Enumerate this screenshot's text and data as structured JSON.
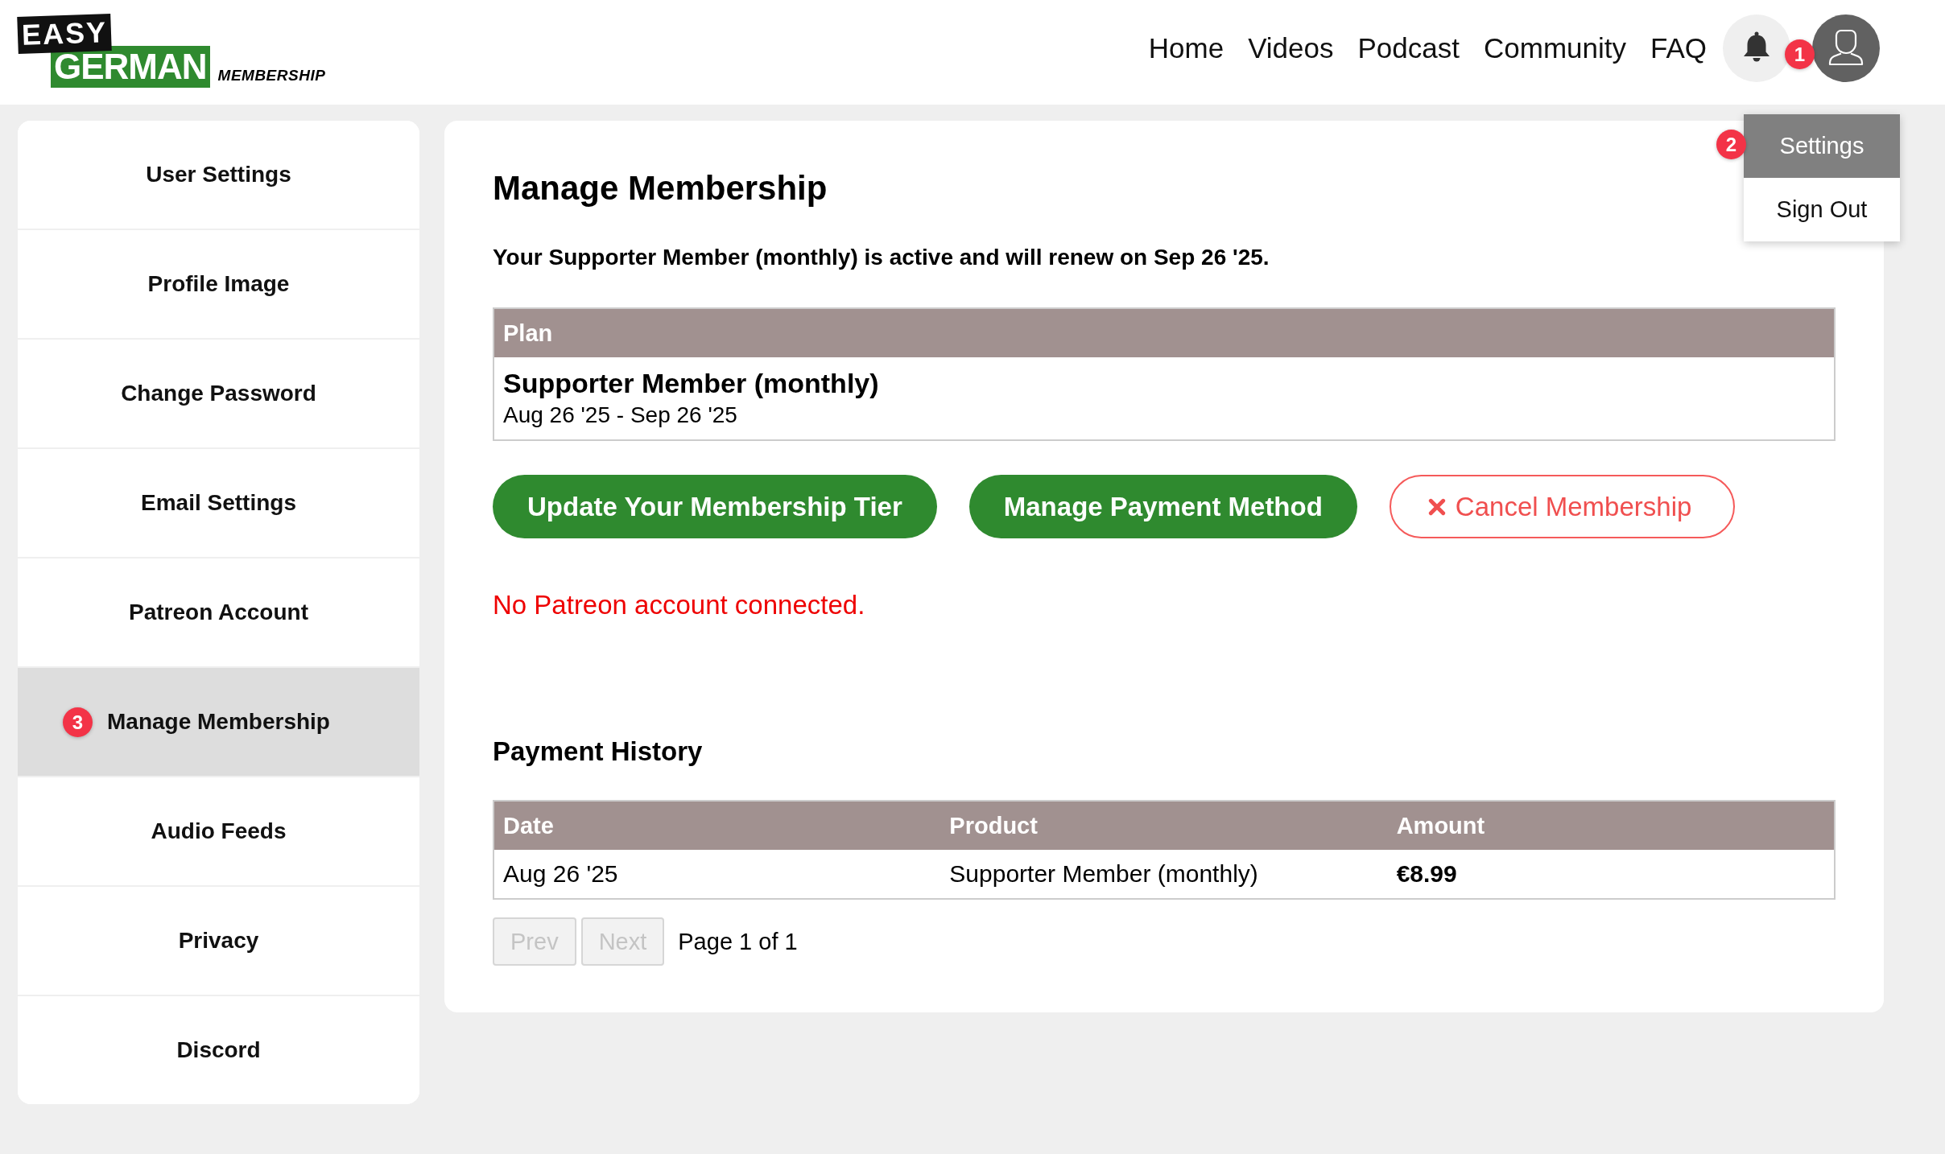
{
  "header": {
    "logo": {
      "word_1": "EASY",
      "word_2": "GERMAN",
      "tagline": "MEMBERSHIP"
    },
    "nav": [
      {
        "label": "Home"
      },
      {
        "label": "Videos"
      },
      {
        "label": "Podcast"
      },
      {
        "label": "Community"
      },
      {
        "label": "FAQ"
      }
    ],
    "account_marker": "1",
    "account_menu": {
      "items": [
        {
          "label": "Settings",
          "selected": true,
          "marker": "2"
        },
        {
          "label": "Sign Out",
          "selected": false
        }
      ]
    }
  },
  "sidebar": {
    "items": [
      {
        "label": "User Settings",
        "selected": false
      },
      {
        "label": "Profile Image",
        "selected": false
      },
      {
        "label": "Change Password",
        "selected": false
      },
      {
        "label": "Email Settings",
        "selected": false
      },
      {
        "label": "Patreon Account",
        "selected": false
      },
      {
        "label": "Manage Membership",
        "selected": true,
        "marker": "3"
      },
      {
        "label": "Audio Feeds",
        "selected": false
      },
      {
        "label": "Privacy",
        "selected": false
      },
      {
        "label": "Discord",
        "selected": false
      }
    ]
  },
  "main": {
    "title": "Manage Membership",
    "status": "Your Supporter Member (monthly) is active and will renew on Sep 26 '25.",
    "plan_table": {
      "columns": [
        "Plan"
      ],
      "rows": [
        {
          "name": "Supporter Member (monthly)",
          "period": "Aug 26 '25 - Sep 26 '25"
        }
      ]
    },
    "buttons": [
      {
        "label": "Update Your Membership Tier",
        "kind": "primary"
      },
      {
        "label": "Manage Payment Method",
        "kind": "primary"
      },
      {
        "label": "Cancel Membership",
        "kind": "danger"
      }
    ],
    "notice": "No Patreon account connected.",
    "payment_history": {
      "title": "Payment History",
      "columns": [
        "Date",
        "Product",
        "Amount"
      ],
      "rows": [
        [
          "Aug 26 '25",
          "Supporter Member (monthly)",
          "€8.99"
        ]
      ],
      "pagination": {
        "prev": {
          "label": "Prev",
          "disabled": true
        },
        "next": {
          "label": "Next",
          "disabled": true
        },
        "page_info": "Page 1 of 1"
      }
    }
  }
}
